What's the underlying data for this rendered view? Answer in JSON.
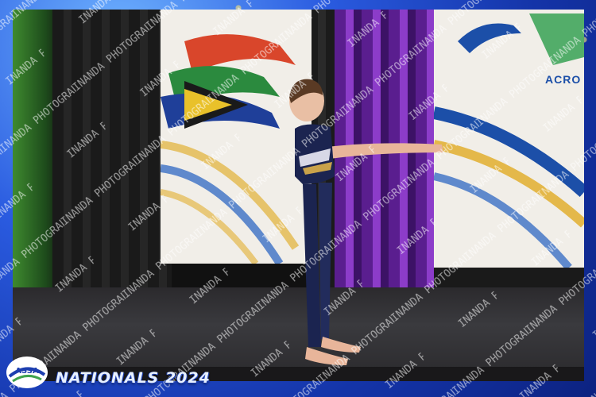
{
  "scene": {
    "event_caption": "NATIONALS 2024",
    "logo_text": "ASSA",
    "banner_text": "ACRO",
    "watermark_text": "INANDA PHOTOGRAPHY"
  },
  "colors": {
    "frame_blue": "#1d3fb0",
    "banner_cream": "#f1eee8",
    "purple_curtain": "#8c3cc9",
    "green_curtain": "#3e8a2f",
    "leotard_navy": "#1b2450"
  },
  "icons": [
    "sa-flag-graphic",
    "acro-gymnast-silhouette",
    "assa-logo"
  ]
}
